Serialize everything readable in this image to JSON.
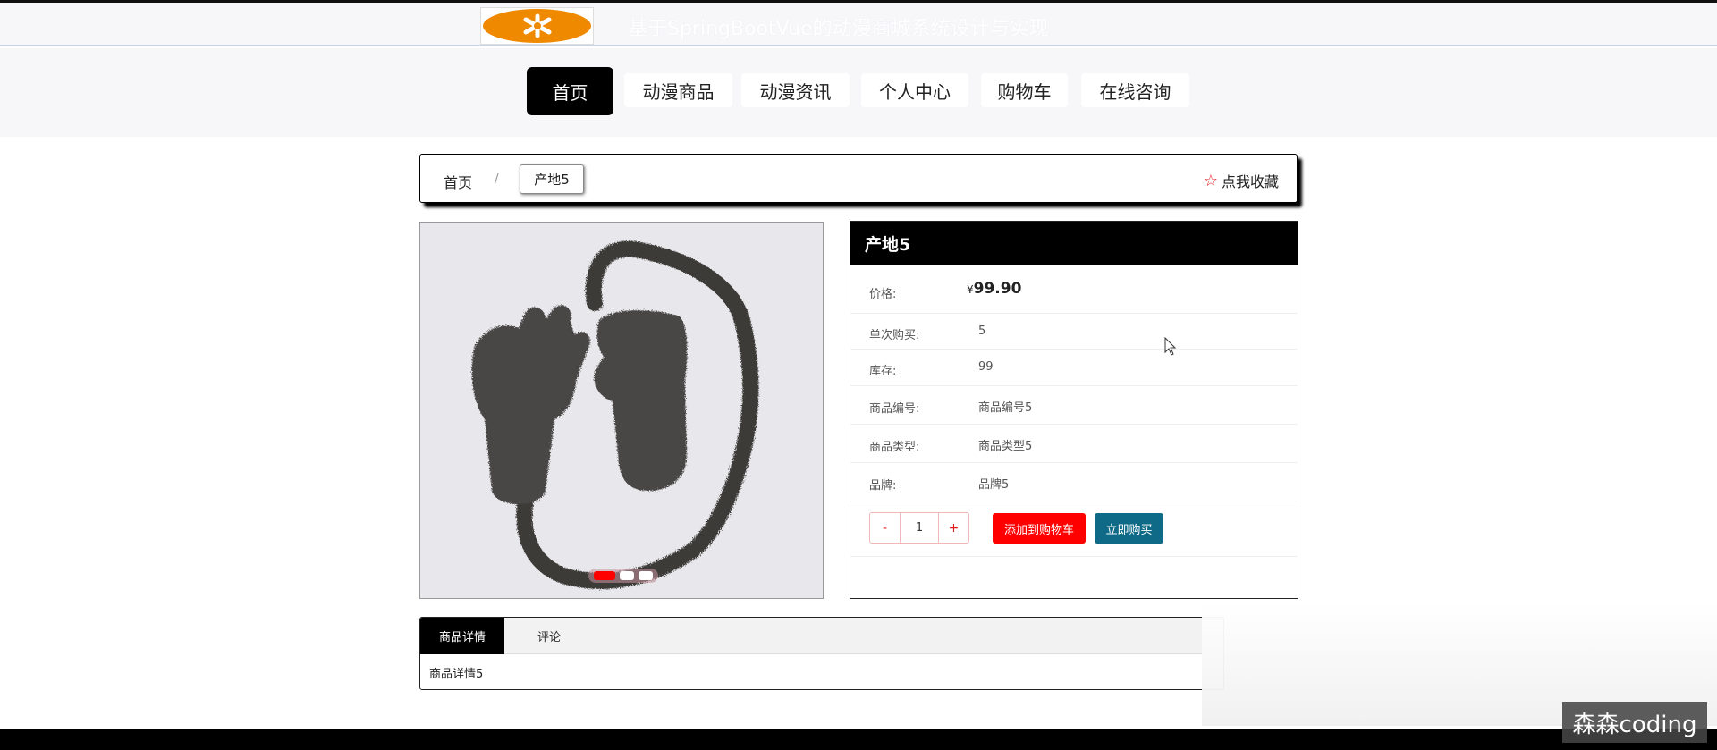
{
  "header": {
    "title": "基于SpringBootVue的动漫商城系统设计与实现",
    "logo_icon": "asterisk-logo-icon"
  },
  "nav": {
    "items": [
      {
        "label": "首页",
        "active": true
      },
      {
        "label": "动漫商品",
        "active": false
      },
      {
        "label": "动漫资讯",
        "active": false
      },
      {
        "label": "个人中心",
        "active": false
      },
      {
        "label": "购物车",
        "active": false
      },
      {
        "label": "在线咨询",
        "active": false
      }
    ]
  },
  "breadcrumb": {
    "home": "首页",
    "separator": "/",
    "current": "产地5",
    "favorite_label": "点我收藏",
    "favorite_icon": "star-outline-icon"
  },
  "carousel": {
    "slides": 3,
    "active_index": 0,
    "image_desc": "fur-gloves-and-scarf-image"
  },
  "product": {
    "title": "产地5",
    "price_label": "价格:",
    "price_symbol": "¥",
    "price": "99.90",
    "fields": [
      {
        "label": "单次购买:",
        "value": "5"
      },
      {
        "label": "库存:",
        "value": "99"
      },
      {
        "label": "商品编号:",
        "value": "商品编号5"
      },
      {
        "label": "商品类型:",
        "value": "商品类型5"
      },
      {
        "label": "品牌:",
        "value": "品牌5"
      }
    ],
    "qty_minus": "-",
    "qty_value": "1",
    "qty_plus": "+",
    "add_to_cart": "添加到购物车",
    "buy_now": "立即购买"
  },
  "details": {
    "tabs": [
      "商品详情",
      "评论"
    ],
    "active_tab": 0,
    "content": "商品详情5"
  },
  "watermark": "森森coding",
  "colors": {
    "accent_black": "#000000",
    "cart_red": "#ff0000",
    "buy_teal": "#0e6a86",
    "logo_orange": "#ef8a00"
  }
}
